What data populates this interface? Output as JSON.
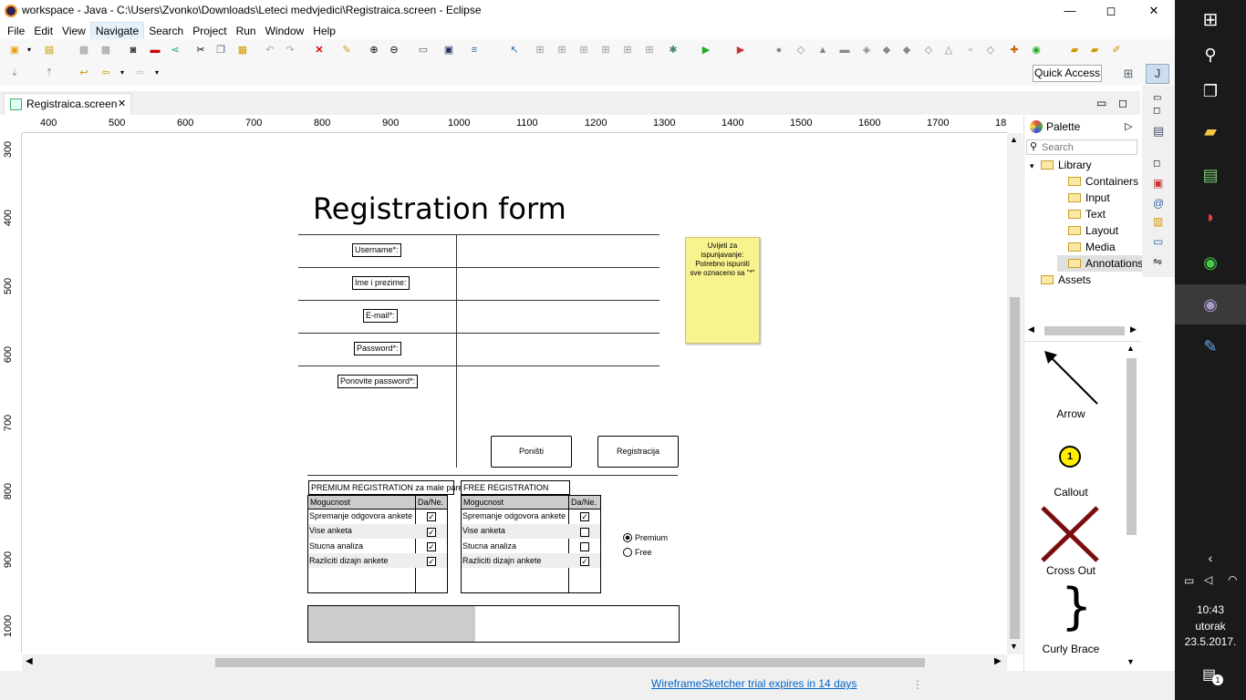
{
  "window": {
    "title": "workspace - Java - C:\\Users\\Zvonko\\Downloads\\Leteci medvjedici\\Registraica.screen - Eclipse",
    "min": "—",
    "max": "◻",
    "close": "✕"
  },
  "menu": [
    "File",
    "Edit",
    "View",
    "Navigate",
    "Search",
    "Project",
    "Run",
    "Window",
    "Help"
  ],
  "quick_access": "Quick Access",
  "editor_tab": {
    "label": "Registraica.screen",
    "close": "✕"
  },
  "ruler_h": [
    "400",
    "500",
    "600",
    "700",
    "800",
    "900",
    "1000",
    "1100",
    "1200",
    "1300",
    "1400",
    "1500",
    "1600",
    "1700",
    "18"
  ],
  "ruler_v": [
    "300",
    "400",
    "500",
    "600",
    "700",
    "800",
    "900",
    "1000"
  ],
  "form": {
    "title": "Registration form",
    "labels": [
      "Username*:",
      "Ime i prezime:",
      "E-mail*:",
      "Password*:",
      "Ponovite password*:"
    ],
    "note": "Uvijeti za ispunjavanje: Potrebno ispuniti sve oznaceno sa \"*\"",
    "btn_cancel": "Poništi",
    "btn_register": "Registracija",
    "premium_title": "PREMIUM REGISTRATION za male pare",
    "free_title": "FREE REGISTRATION",
    "col1": "Mogucnost",
    "col2": "Da/Ne.",
    "rows": [
      "Spremanje odgovora ankete",
      "Vise anketa",
      "Stucna analiza",
      "Razliciti dizajn ankete"
    ],
    "premium_checks": [
      true,
      true,
      true,
      true
    ],
    "free_checks": [
      true,
      false,
      false,
      true
    ],
    "radio_premium": "Premium",
    "radio_free": "Free",
    "progress": 0.45
  },
  "palette": {
    "title": "Palette",
    "search_placeholder": "Search",
    "tree": [
      {
        "label": "Library",
        "indent": 0
      },
      {
        "label": "Containers",
        "indent": 1
      },
      {
        "label": "Input",
        "indent": 1
      },
      {
        "label": "Text",
        "indent": 1
      },
      {
        "label": "Layout",
        "indent": 1
      },
      {
        "label": "Media",
        "indent": 1
      },
      {
        "label": "Annotations",
        "indent": 1
      },
      {
        "label": "Assets",
        "indent": 0
      }
    ],
    "items": [
      "Arrow",
      "Callout",
      "Cross Out",
      "Curly Brace"
    ],
    "callout_number": "1"
  },
  "status": {
    "trial": "WireframeSketcher trial expires in 14 days"
  },
  "taskbar": {
    "time": "10:43",
    "day": "utorak",
    "date": "23.5.2017.",
    "notif_count": "1"
  },
  "colors": {
    "note_bg": "#f7f38f",
    "crossout": "#7a0e0e",
    "callout_bg": "#ffee00",
    "link": "#0066cc",
    "taskbar": "#1a1a1a"
  }
}
